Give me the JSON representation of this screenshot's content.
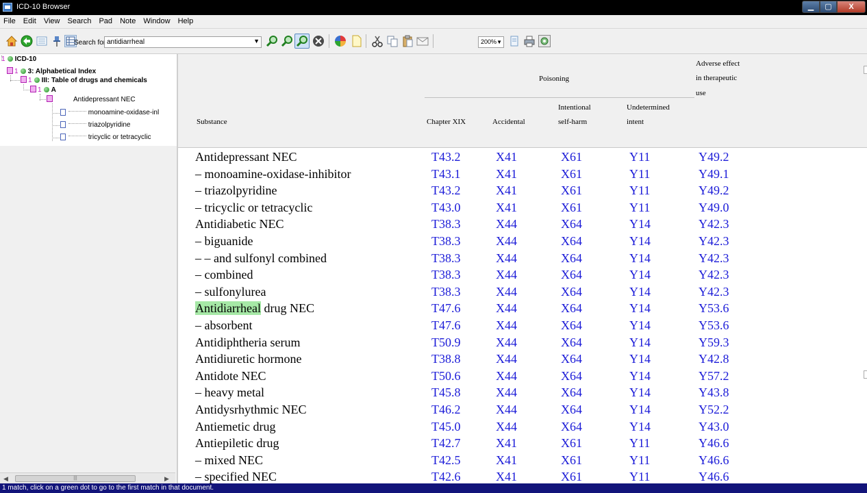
{
  "window": {
    "title": "ICD-10 Browser",
    "close_label": "X"
  },
  "menu": [
    "File",
    "Edit",
    "View",
    "Search",
    "Pad",
    "Note",
    "Window",
    "Help"
  ],
  "toolbar": {
    "search_label": "Search for",
    "search_value": "antidiarrheal",
    "zoom": "200%",
    "icons": [
      "home-icon",
      "back-icon",
      "toc-icon",
      "pin-icon",
      "grid-icon",
      "search-prev-icon",
      "search-next-icon",
      "search-current-icon",
      "stop-icon",
      "color-wheel-icon",
      "new-note-icon",
      "cut-icon",
      "copy-icon",
      "paste-icon",
      "email-icon",
      "page-icon",
      "print-icon",
      "settings-icon"
    ]
  },
  "tree": {
    "root": {
      "count": "1",
      "label": "ICD-10"
    },
    "chapter": {
      "count": "1",
      "label": "3: Alphabetical Index"
    },
    "table": {
      "count": "1",
      "label": "III: Table of drugs and chemicals"
    },
    "letter": {
      "count": "1",
      "label": "A"
    },
    "entry": {
      "label": "Antidepressant NEC"
    },
    "children": [
      "monoamine-oxidase-inl",
      "triazolpyridine",
      "tricyclic or tetracyclic"
    ]
  },
  "table_header": {
    "poisoning": "Poisoning",
    "adverse1": "Adverse effect",
    "adverse2": "in therapeutic",
    "adverse3": "use",
    "substance": "Substance",
    "chapter": "Chapter XIX",
    "accidental": "Accidental",
    "intentional1": "Intentional",
    "intentional2": "self-harm",
    "undetermined1": "Undetermined",
    "undetermined2": "intent"
  },
  "rows": [
    {
      "substance": "Antidepressant NEC",
      "codes": [
        "T43.2",
        "X41",
        "X61",
        "Y11",
        "Y49.2"
      ]
    },
    {
      "substance": "– monoamine-oxidase-inhibitor",
      "codes": [
        "T43.1",
        "X41",
        "X61",
        "Y11",
        "Y49.1"
      ]
    },
    {
      "substance": "– triazolpyridine",
      "codes": [
        "T43.2",
        "X41",
        "X61",
        "Y11",
        "Y49.2"
      ]
    },
    {
      "substance": "– tricyclic or tetracyclic",
      "codes": [
        "T43.0",
        "X41",
        "X61",
        "Y11",
        "Y49.0"
      ]
    },
    {
      "substance": "Antidiabetic NEC",
      "codes": [
        "T38.3",
        "X44",
        "X64",
        "Y14",
        "Y42.3"
      ]
    },
    {
      "substance": "– biguanide",
      "codes": [
        "T38.3",
        "X44",
        "X64",
        "Y14",
        "Y42.3"
      ]
    },
    {
      "substance": "– – and sulfonyl combined",
      "codes": [
        "T38.3",
        "X44",
        "X64",
        "Y14",
        "Y42.3"
      ]
    },
    {
      "substance": "– combined",
      "codes": [
        "T38.3",
        "X44",
        "X64",
        "Y14",
        "Y42.3"
      ]
    },
    {
      "substance": "– sulfonylurea",
      "codes": [
        "T38.3",
        "X44",
        "X64",
        "Y14",
        "Y42.3"
      ]
    },
    {
      "substance": "drug NEC",
      "highlight": "Antidiarrheal",
      "codes": [
        "T47.6",
        "X44",
        "X64",
        "Y14",
        "Y53.6"
      ]
    },
    {
      "substance": "– absorbent",
      "codes": [
        "T47.6",
        "X44",
        "X64",
        "Y14",
        "Y53.6"
      ]
    },
    {
      "substance": "Antidiphtheria serum",
      "codes": [
        "T50.9",
        "X44",
        "X64",
        "Y14",
        "Y59.3"
      ]
    },
    {
      "substance": "Antidiuretic hormone",
      "codes": [
        "T38.8",
        "X44",
        "X64",
        "Y14",
        "Y42.8"
      ]
    },
    {
      "substance": "Antidote NEC",
      "codes": [
        "T50.6",
        "X44",
        "X64",
        "Y14",
        "Y57.2"
      ]
    },
    {
      "substance": "– heavy metal",
      "codes": [
        "T45.8",
        "X44",
        "X64",
        "Y14",
        "Y43.8"
      ]
    },
    {
      "substance": "Antidysrhythmic NEC",
      "codes": [
        "T46.2",
        "X44",
        "X64",
        "Y14",
        "Y52.2"
      ]
    },
    {
      "substance": "Antiemetic drug",
      "codes": [
        "T45.0",
        "X44",
        "X64",
        "Y14",
        "Y43.0"
      ]
    },
    {
      "substance": "Antiepiletic drug",
      "codes": [
        "T42.7",
        "X41",
        "X61",
        "Y11",
        "Y46.6"
      ]
    },
    {
      "substance": "– mixed NEC",
      "codes": [
        "T42.5",
        "X41",
        "X61",
        "Y11",
        "Y46.6"
      ]
    },
    {
      "substance": "– specified NEC",
      "codes": [
        "T42.6",
        "X41",
        "X61",
        "Y11",
        "Y46.6"
      ]
    }
  ],
  "status": "1 match, click on a green dot to go to the first match in that document.",
  "colors": {
    "code_text": "#1b1bd8",
    "highlight": "#a6e8a6",
    "status_bg": "#12147a",
    "tree_marker": "#c020c0"
  }
}
